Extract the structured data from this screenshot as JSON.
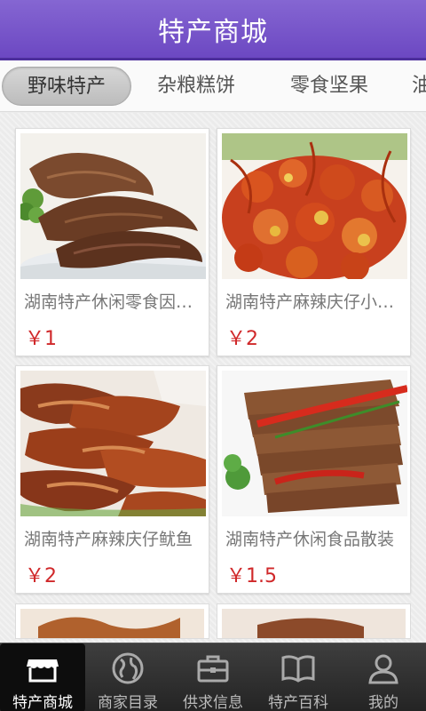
{
  "header": {
    "title": "特产商城"
  },
  "tabs": [
    {
      "label": "野味特产",
      "active": true
    },
    {
      "label": "杂粮糕饼",
      "active": false
    },
    {
      "label": "零食坚果",
      "active": false
    },
    {
      "label": "油",
      "active": false
    }
  ],
  "products": [
    {
      "name": "湖南特产休闲零食因为爱情鸭脖",
      "price": "￥1"
    },
    {
      "name": "湖南特产麻辣庆仔小龙虾",
      "price": "￥2"
    },
    {
      "name": "湖南特产麻辣庆仔鱿鱼",
      "price": "￥2"
    },
    {
      "name": "湖南特产休闲食品散装",
      "price": "￥1.5"
    }
  ],
  "bottom_nav": [
    {
      "label": "特产商城",
      "icon": "store-icon",
      "active": true
    },
    {
      "label": "商家目录",
      "icon": "globe-icon",
      "active": false
    },
    {
      "label": "供求信息",
      "icon": "briefcase-icon",
      "active": false
    },
    {
      "label": "特产百科",
      "icon": "book-icon",
      "active": false
    },
    {
      "label": "我的",
      "icon": "user-icon",
      "active": false
    }
  ],
  "colors": {
    "header": "#7455c6",
    "price": "#d0282a",
    "bottom_bar": "#2e2e2e"
  }
}
